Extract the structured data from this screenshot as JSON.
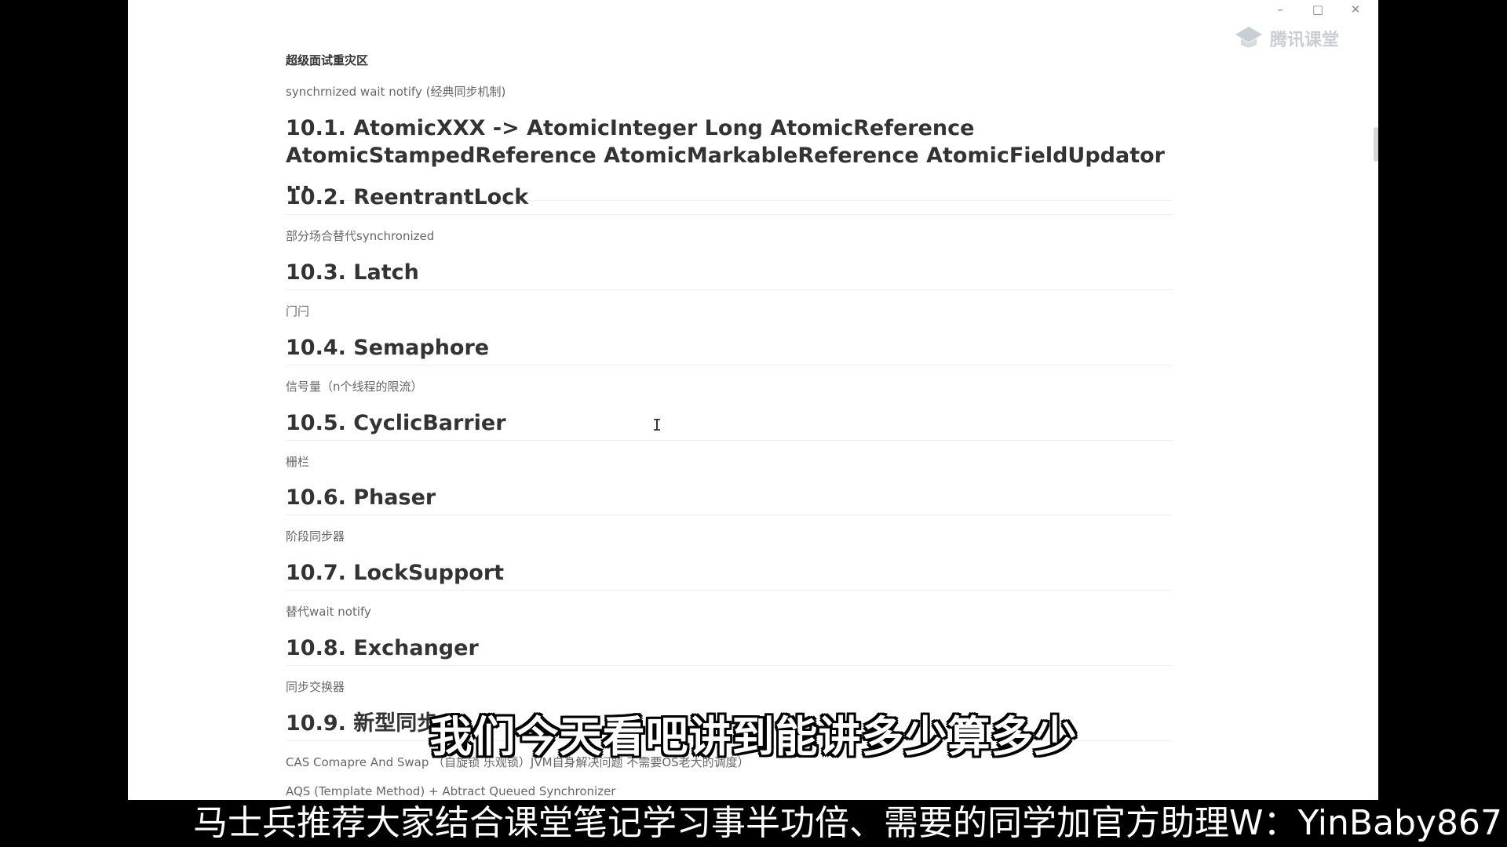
{
  "window": {
    "controls": {
      "minimize": "–",
      "maximize": "□",
      "close": "✕"
    },
    "logo_text": "腾讯课堂"
  },
  "document": {
    "zone_title": "超级面试重灾区",
    "zone_subtitle": "synchrnized wait notify (经典同步机制)",
    "sections": [
      {
        "heading": "10.1. AtomicXXX -> AtomicInteger Long AtomicReference",
        "heading_line2": "AtomicStampedReference AtomicMarkableReference AtomicFieldUpdator ...",
        "desc": ""
      },
      {
        "heading": "10.2. ReentrantLock",
        "desc": "部分场合替代synchronized"
      },
      {
        "heading": "10.3. Latch",
        "desc": "门闩"
      },
      {
        "heading": "10.4. Semaphore",
        "desc": "信号量（n个线程的限流）"
      },
      {
        "heading": "10.5. CyclicBarrier",
        "desc": "栅栏"
      },
      {
        "heading": "10.6. Phaser",
        "desc": "阶段同步器"
      },
      {
        "heading": "10.7. LockSupport",
        "desc": "替代wait notify"
      },
      {
        "heading": "10.8. Exchanger",
        "desc": "同步交换器"
      },
      {
        "heading": "10.9. 新型同步",
        "desc": "CAS Comapre And Swap （自旋锁 乐观锁）JVM自身解决问题 不需要OS老大的调度）"
      }
    ],
    "extra_line": "AQS (Template Method) + Abtract Queued Synchronizer"
  },
  "video_subtitle": "我们今天看吧讲到能讲多少算多少",
  "banner_text": "马士兵推荐大家结合课堂笔记学习事半功倍、需要的同学加官方助理W：YinBaby867"
}
